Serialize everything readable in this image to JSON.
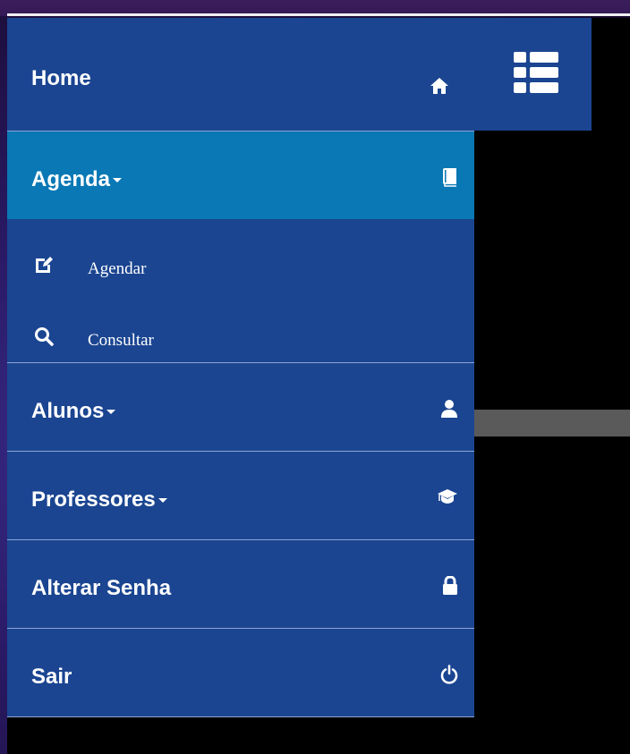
{
  "header": {
    "home_label": "Home",
    "home_icon": "home-icon",
    "toggle_icon": "list-icon"
  },
  "menu": {
    "items": [
      {
        "label": "Agenda",
        "icon": "book-icon",
        "active": true
      },
      {
        "label": "Alunos",
        "icon": "user-icon"
      },
      {
        "label": "Professores",
        "icon": "graduation-cap-icon"
      },
      {
        "label": "Alterar Senha",
        "icon": "lock-icon"
      },
      {
        "label": "Sair",
        "icon": "power-icon"
      }
    ],
    "agenda_submenu": [
      {
        "label": "Agendar",
        "icon": "edit-icon"
      },
      {
        "label": "Consultar",
        "icon": "search-icon"
      }
    ]
  },
  "colors": {
    "menu_bg": "#1b4591",
    "active_bg": "#0978b5",
    "divider": "#8ea5d6"
  }
}
